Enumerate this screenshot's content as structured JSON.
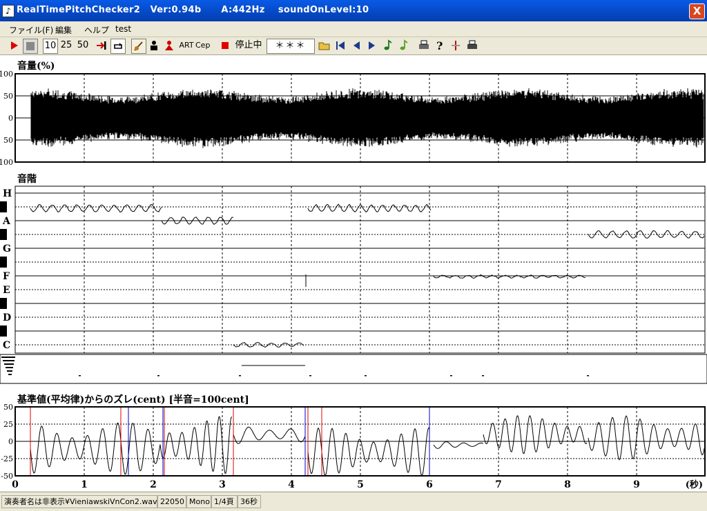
{
  "window": {
    "title": "RealTimePitchChecker2   Ver:0.94b      A:442Hz    soundOnLevel:10",
    "close_glyph": "X"
  },
  "menu": [
    "ファイル(F)",
    "編集",
    "ヘルプ",
    "test"
  ],
  "toolbar": {
    "speed1": "10",
    "speed2": "25",
    "speed3": "50",
    "art": "ART",
    "cep": "Cep",
    "state": "停止中",
    "note_display": "＊＊＊"
  },
  "volume_panel": {
    "title": "音量(%)",
    "y_labels": [
      "100",
      "50",
      "0",
      "50",
      "100"
    ]
  },
  "scale_panel": {
    "title": "音階",
    "notes": [
      "H",
      "A",
      "G",
      "F",
      "E",
      "D",
      "C"
    ]
  },
  "deviation_panel": {
    "title": "基準値(平均律)からのズレ(cent) [半音=100cent]",
    "y_labels": [
      "50",
      "25",
      "0",
      "-25",
      "-50"
    ]
  },
  "time_axis": {
    "ticks": [
      "0",
      "1",
      "2",
      "3",
      "4",
      "5",
      "6",
      "7",
      "8",
      "9"
    ],
    "unit": "(秒)"
  },
  "statusbar": {
    "file": "演奏者名は非表示¥VieniawskiVnCon2.wav",
    "rate": "22050",
    "channels": "Mono",
    "page": "1/4頁",
    "duration": "36秒"
  },
  "colors": {
    "title_bar": "#0548c4",
    "red_marker": "#e00000",
    "blue_marker": "#0000cc"
  },
  "icons": [
    "play-icon",
    "stop-icon",
    "jump-end-icon",
    "loop-icon",
    "violin-icon",
    "person-black-icon",
    "person-red-icon",
    "record-stop-icon",
    "open-folder-icon",
    "first-icon",
    "prev-icon",
    "next-icon",
    "note-icon",
    "note2-icon",
    "print-icon",
    "help-icon",
    "marker-icon",
    "print2-icon"
  ]
}
